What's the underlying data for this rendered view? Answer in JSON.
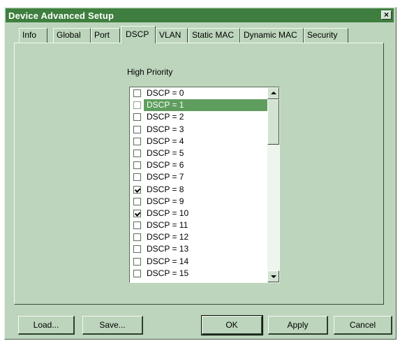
{
  "window": {
    "title": "Device Advanced Setup",
    "close_label": "×"
  },
  "tabs": [
    {
      "label": "Info",
      "active": false
    },
    {
      "label": "Global",
      "active": false
    },
    {
      "label": "Port",
      "active": false
    },
    {
      "label": "DSCP",
      "active": true
    },
    {
      "label": "VLAN",
      "active": false
    },
    {
      "label": "Static MAC",
      "active": false
    },
    {
      "label": "Dynamic MAC",
      "active": false
    },
    {
      "label": "Security",
      "active": false
    }
  ],
  "dscp": {
    "list_label": "High Priority",
    "items": [
      {
        "label": "DSCP = 0",
        "checked": false,
        "selected": false
      },
      {
        "label": "DSCP = 1",
        "checked": false,
        "selected": true
      },
      {
        "label": "DSCP = 2",
        "checked": false,
        "selected": false
      },
      {
        "label": "DSCP = 3",
        "checked": false,
        "selected": false
      },
      {
        "label": "DSCP = 4",
        "checked": false,
        "selected": false
      },
      {
        "label": "DSCP = 5",
        "checked": false,
        "selected": false
      },
      {
        "label": "DSCP = 6",
        "checked": false,
        "selected": false
      },
      {
        "label": "DSCP = 7",
        "checked": false,
        "selected": false
      },
      {
        "label": "DSCP = 8",
        "checked": true,
        "selected": false
      },
      {
        "label": "DSCP = 9",
        "checked": false,
        "selected": false
      },
      {
        "label": "DSCP = 10",
        "checked": true,
        "selected": false
      },
      {
        "label": "DSCP = 11",
        "checked": false,
        "selected": false
      },
      {
        "label": "DSCP = 12",
        "checked": false,
        "selected": false
      },
      {
        "label": "DSCP = 13",
        "checked": false,
        "selected": false
      },
      {
        "label": "DSCP = 14",
        "checked": false,
        "selected": false
      },
      {
        "label": "DSCP = 15",
        "checked": false,
        "selected": false
      }
    ]
  },
  "buttons": {
    "load": "Load...",
    "save": "Save...",
    "ok": "OK",
    "apply": "Apply",
    "cancel": "Cancel"
  },
  "colors": {
    "dialog_bg": "#bcd5bc",
    "titlebar": "#3e7e3e",
    "selection": "#5f9d5f"
  }
}
